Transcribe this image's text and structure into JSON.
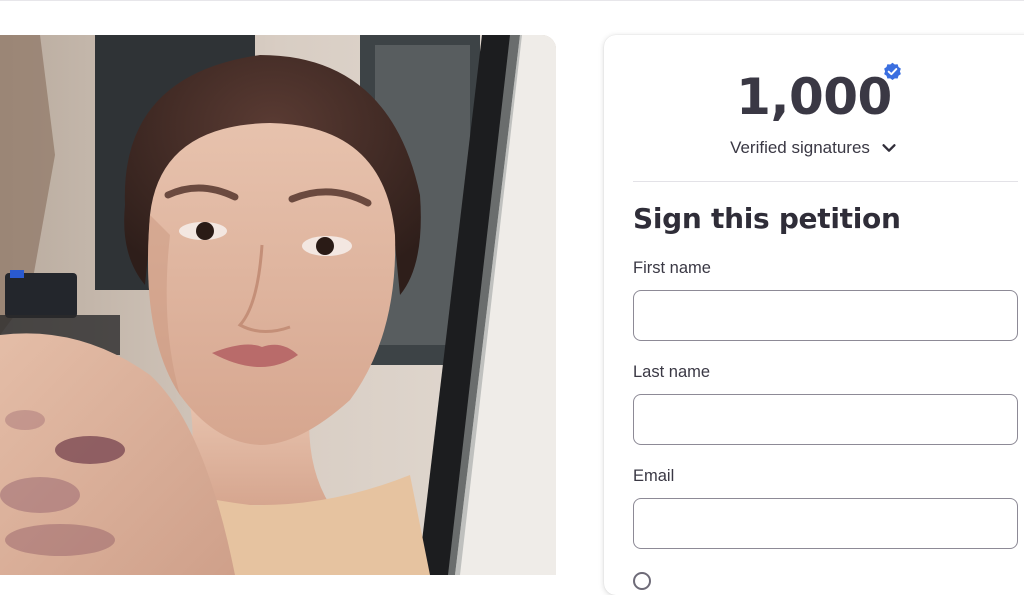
{
  "petition": {
    "signature_count": "1,000",
    "verified_label": "Verified signatures",
    "form_title": "Sign this petition"
  },
  "form": {
    "first_name": {
      "label": "First name",
      "value": "",
      "placeholder": ""
    },
    "last_name": {
      "label": "Last name",
      "value": "",
      "placeholder": ""
    },
    "email": {
      "label": "Email",
      "value": "",
      "placeholder": ""
    }
  },
  "icons": {
    "verified": "verified-check-badge",
    "expand": "chevron-down"
  },
  "colors": {
    "verified_badge": "#3b6fe0",
    "text": "#3a3844",
    "input_border": "#8d8a96"
  }
}
